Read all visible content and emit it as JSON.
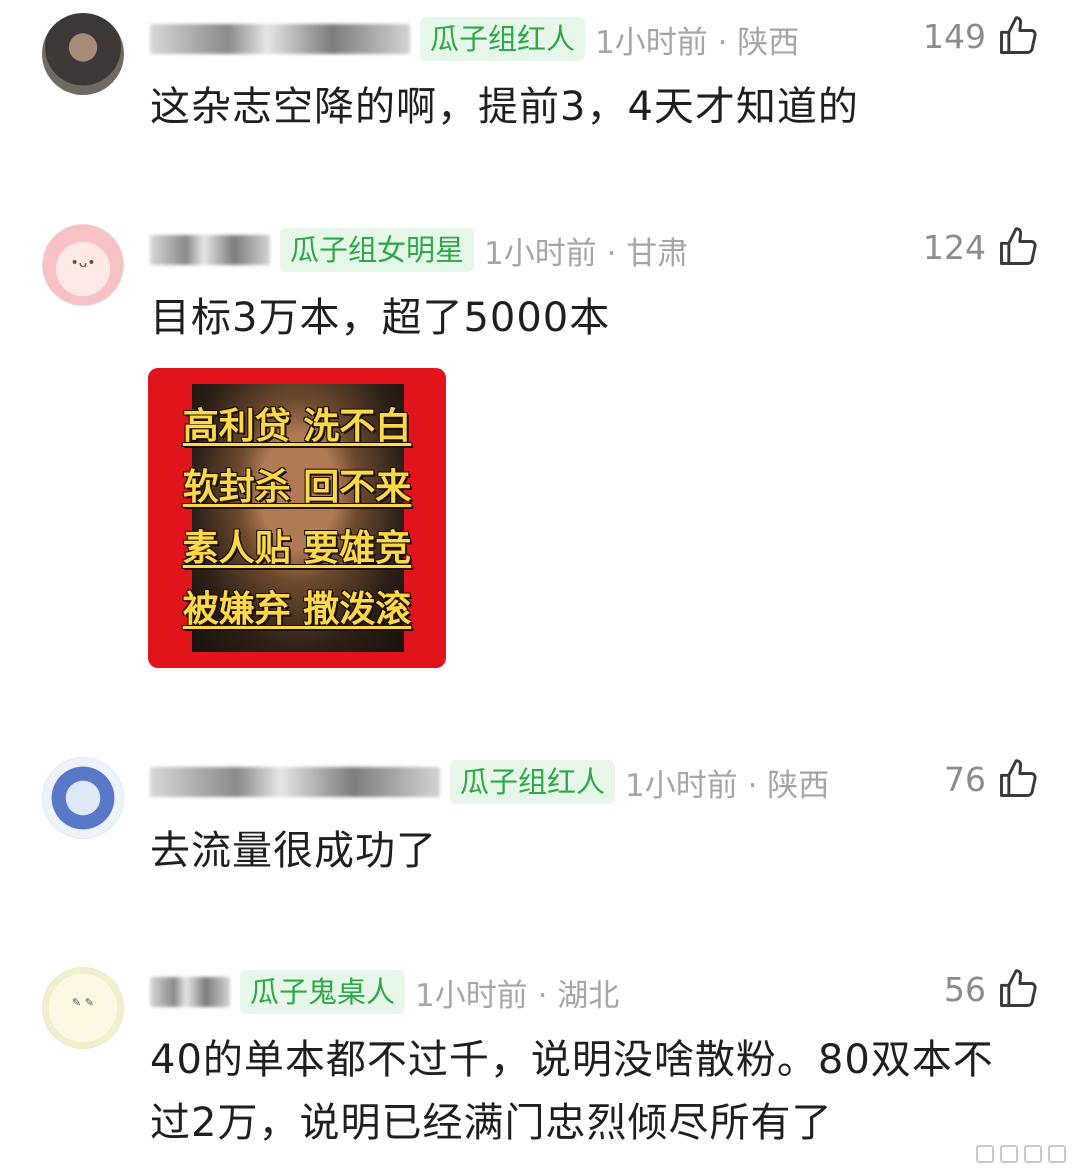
{
  "comments": [
    {
      "badge": "瓜子组红人",
      "time_location": "1小时前 · 陕西",
      "likes": "149",
      "text": "这杂志空降的啊，提前3，4天才知道的"
    },
    {
      "badge": "瓜子组女明星",
      "time_location": "1小时前 · 甘肃",
      "likes": "124",
      "text": "目标3万本，超了5000本",
      "image_lines": [
        "高利贷 洗不白",
        "软封杀 回不来",
        "素人贴 要雄竞",
        "被嫌弃 撒泼滚"
      ]
    },
    {
      "badge": "瓜子组红人",
      "time_location": "1小时前 · 陕西",
      "likes": "76",
      "text": "去流量很成功了"
    },
    {
      "badge": "瓜子鬼桌人",
      "time_location": "1小时前 · 湖北",
      "likes": "56",
      "text": "40的单本都不过千，说明没啥散粉。80双本不过2万，说明已经满门忠烈倾尽所有了"
    }
  ],
  "icons": {
    "like": "thumbs-up-icon",
    "watermark": "weibo-watermark-icon"
  },
  "colors": {
    "badge_bg": "#e6f6e8",
    "badge_text": "#2fa84a",
    "meme_bg": "#e0141a",
    "meme_text": "#ffd84a"
  }
}
